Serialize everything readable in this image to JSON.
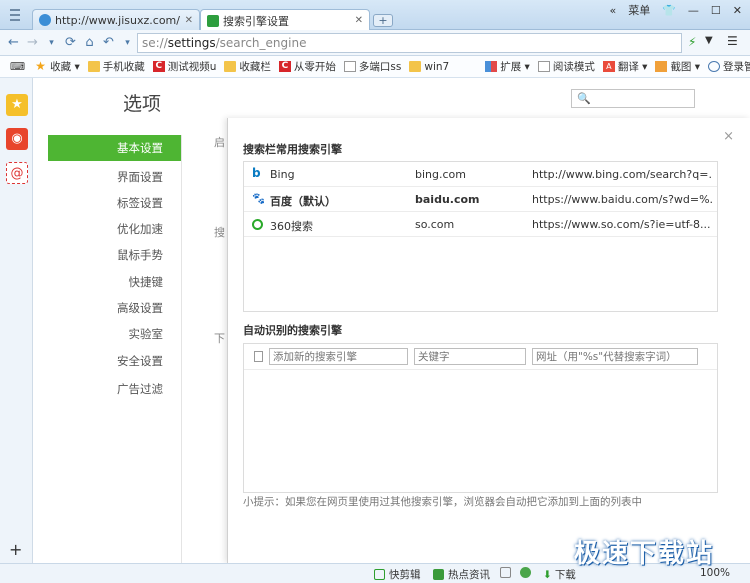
{
  "tabs": [
    {
      "title": "http://www.jisuxz.com/",
      "icon": "globe-icon",
      "active": false
    },
    {
      "title": "搜索引擎设置",
      "icon": "wrench-icon",
      "active": true
    }
  ],
  "window": {
    "menu_label": "菜单",
    "skin_icon": "shirt-icon",
    "new_tab_label": "+"
  },
  "address": {
    "scheme": "se://",
    "host": "settings",
    "path": "/search_engine"
  },
  "bookmarks": [
    {
      "label": "收藏",
      "icon": "star-icon"
    },
    {
      "label": "手机收藏",
      "icon": "folder-icon"
    },
    {
      "label": "测试视频u",
      "icon": "c-logo-icon"
    },
    {
      "label": "收藏栏",
      "icon": "folder-icon"
    },
    {
      "label": "从零开始",
      "icon": "c-logo-icon"
    },
    {
      "label": "多端口ss",
      "icon": "page-icon"
    },
    {
      "label": "win7",
      "icon": "folder-icon"
    }
  ],
  "bookmark_tools": [
    {
      "label": "扩展"
    },
    {
      "label": "阅读模式"
    },
    {
      "label": "翻译"
    },
    {
      "label": "截图"
    },
    {
      "label": "登录管家"
    }
  ],
  "settings": {
    "title": "选项",
    "nav": [
      {
        "label": "基本设置",
        "active": true
      },
      {
        "label": "界面设置"
      },
      {
        "label": "标签设置"
      },
      {
        "label": "优化加速"
      },
      {
        "label": "鼠标手势"
      },
      {
        "label": "快捷键"
      },
      {
        "label": "高级设置"
      },
      {
        "label": "实验室"
      },
      {
        "label": "安全设置"
      },
      {
        "label": "广告过滤"
      }
    ],
    "bg_hints": [
      "启",
      "搜",
      "下"
    ]
  },
  "dialog": {
    "close": "×",
    "common_title": "搜索栏常用搜索引擎",
    "engines": [
      {
        "name": "Bing",
        "keyword": "bing.com",
        "url": "http://www.bing.com/search?q=...",
        "icon": "bing-icon",
        "color": "#0a7bc2"
      },
      {
        "name": "百度（默认）",
        "keyword": "baidu.com",
        "url": "https://www.baidu.com/s?wd=%...",
        "icon": "baidu-paw-icon",
        "color": "#2b5fd9",
        "default": true
      },
      {
        "name": "360搜索",
        "keyword": "so.com",
        "url": "https://www.so.com/s?ie=utf-8...",
        "icon": "so360-icon",
        "color": "#2aa92a"
      }
    ],
    "auto_title": "自动识别的搜索引擎",
    "new_engine": {
      "name_placeholder": "添加新的搜索引擎",
      "keyword_placeholder": "关键字",
      "url_placeholder": "网址（用\"%s\"代替搜索字词）"
    },
    "tip": "小提示：如果您在网页里使用过其他搜索引擎，浏览器会自动把它添加到上面的列表中"
  },
  "statusbar": {
    "clip": "快剪辑",
    "news": "热点资讯",
    "download": "下载",
    "zoom": "100%"
  },
  "watermark": "极速下载站",
  "colors": {
    "accent": "#4eb533",
    "tabbar": "#c2d9ef"
  }
}
